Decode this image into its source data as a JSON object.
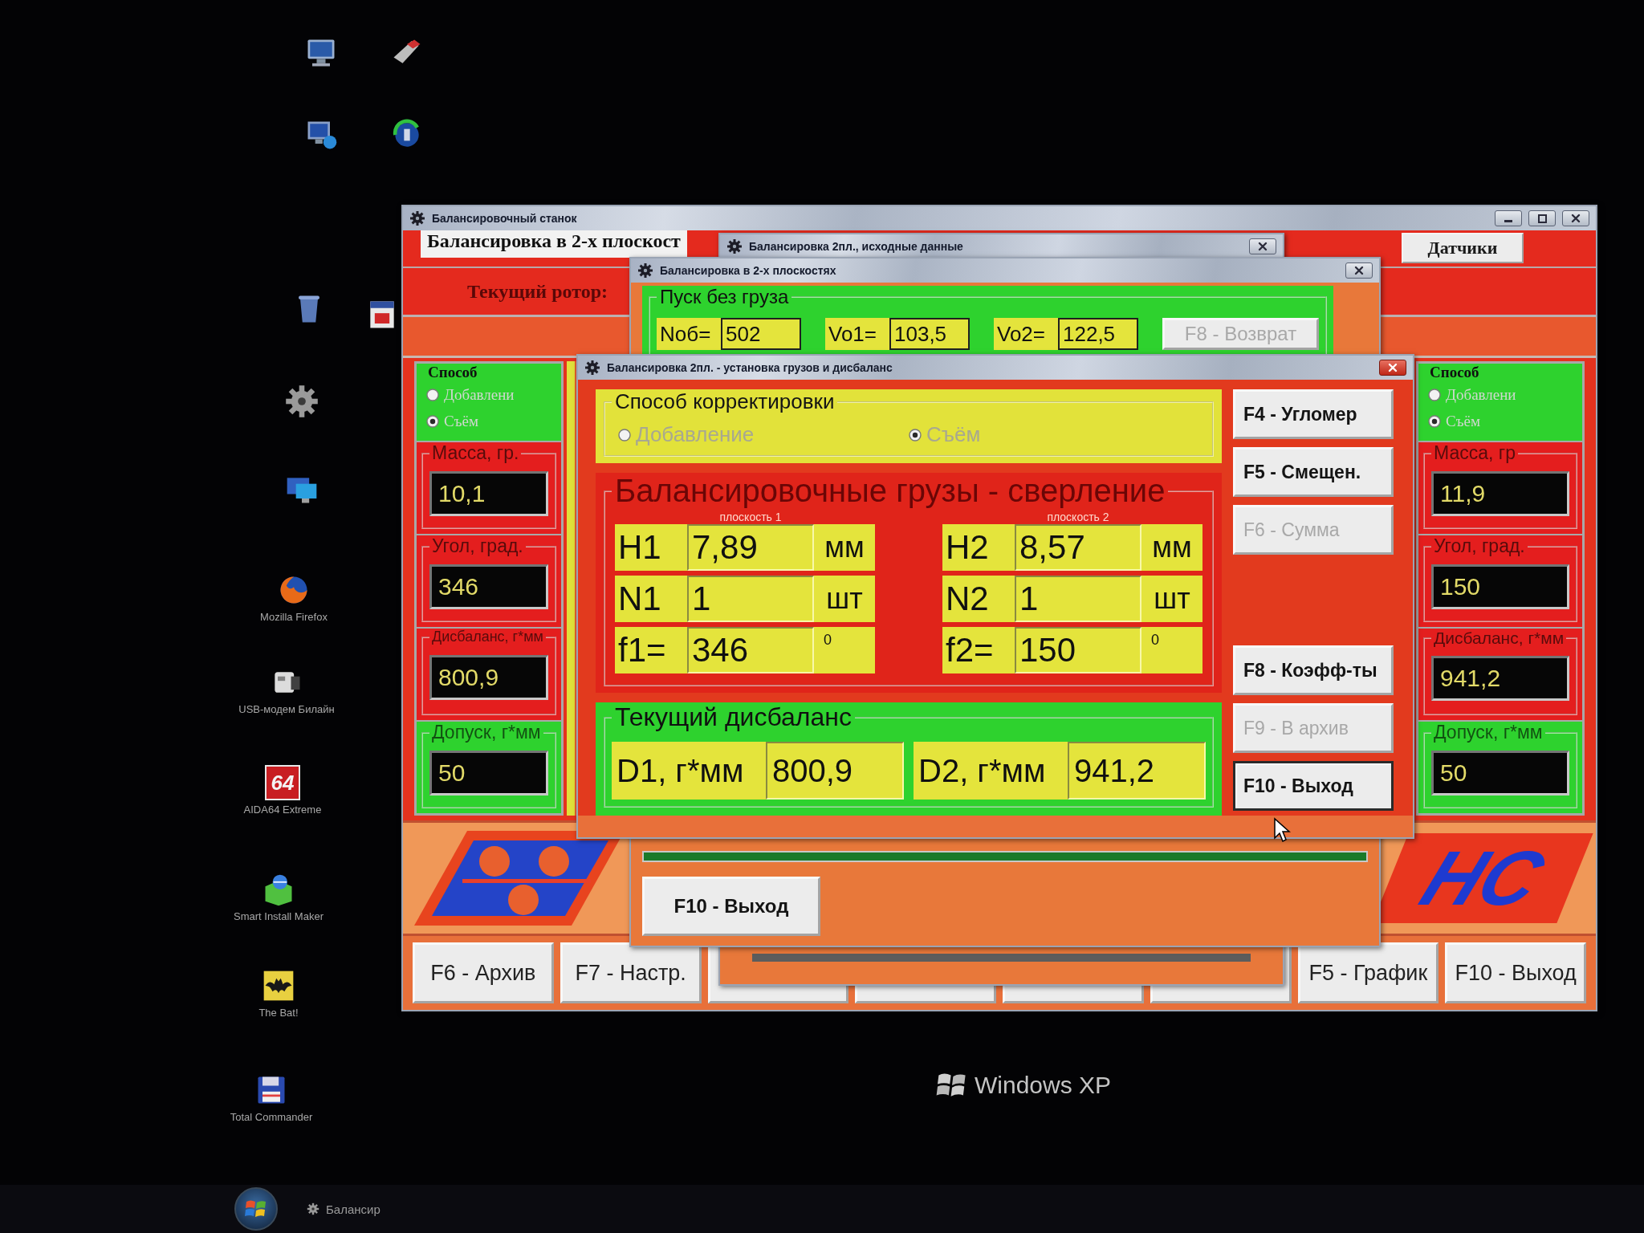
{
  "desktop": {
    "icons": [
      {
        "kind": "computer"
      },
      {
        "kind": "shortcut"
      },
      {
        "kind": "network"
      },
      {
        "kind": "globe"
      },
      {
        "kind": "recycle"
      },
      {
        "kind": "calendar"
      },
      {
        "kind": "gear"
      },
      {
        "kind": "monitor"
      },
      {
        "kind": "browser",
        "label": "Mozilla Firefox"
      },
      {
        "kind": "modem",
        "label": "USB-модем Билайн"
      },
      {
        "kind": "benchmark",
        "text": "64",
        "label": "AIDA64 Extreme"
      },
      {
        "kind": "installer",
        "label": "Smart Install Maker"
      },
      {
        "kind": "bat",
        "label": "The Bat!"
      },
      {
        "kind": "floppy",
        "label": "Total Commander"
      }
    ],
    "taskbar": {
      "items": [
        {
          "label": "Балансир"
        }
      ]
    },
    "bezel_label": "Windows XP"
  },
  "main_window": {
    "title": "Балансировочный станок",
    "header": "Балансировка в 2-х плоскост",
    "sensors_button": "Датчики",
    "rotor_label": "Текущий ротор:",
    "panels": [
      {
        "method": {
          "title": "Способ",
          "options": [
            {
              "label": "Добавлени",
              "selected": false,
              "disabled": true
            },
            {
              "label": "Съём",
              "selected": true,
              "disabled": true
            }
          ]
        },
        "readouts": [
          {
            "title": "Масса, гр.",
            "value": "10,1",
            "color": "#e41e1e"
          },
          {
            "title": "Угол, град.",
            "value": "346",
            "color": "#e41e1e"
          },
          {
            "title": "Дисбаланс, г*мм",
            "value": "800,9",
            "color": "#e41e1e"
          },
          {
            "title": "Допуск, г*мм",
            "value": "50",
            "color": "#2ed22e"
          }
        ]
      },
      {
        "method": {
          "title": "Способ",
          "options": [
            {
              "label": "Добавлени",
              "selected": false,
              "disabled": true
            },
            {
              "label": "Съём",
              "selected": true,
              "disabled": true
            }
          ]
        },
        "readouts": [
          {
            "title": "Масса, гр",
            "value": "11,9",
            "color": "#e41e1e"
          },
          {
            "title": "Угол, град.",
            "value": "150",
            "color": "#e41e1e"
          },
          {
            "title": "Дисбаланс, г*мм",
            "value": "941,2",
            "color": "#e41e1e"
          },
          {
            "title": "Допуск, г*мм",
            "value": "50",
            "color": "#2ed22e"
          }
        ]
      }
    ],
    "logo_text": "НС",
    "buttons": [
      {
        "kind": "labeled",
        "label": "F6 - Архив"
      },
      {
        "kind": "labeled",
        "label": "F7 - Настр."
      },
      {
        "kind": "blank"
      },
      {
        "kind": "blank"
      },
      {
        "kind": "blank"
      },
      {
        "kind": "blank"
      },
      {
        "kind": "labeled",
        "label": "F5 - График"
      },
      {
        "kind": "labeled",
        "label": "F10 - Выход"
      }
    ]
  },
  "input_window": {
    "title": "Балансировка 2пл., исходные данные"
  },
  "run_window": {
    "title": "Балансировка в 2-х плоскостях",
    "group_title": "Пуск без груза",
    "fields": [
      {
        "label": "Nоб=",
        "value": "502"
      },
      {
        "label": "Vo1=",
        "value": "103,5"
      },
      {
        "label": "Vo2=",
        "value": "122,5"
      }
    ],
    "return_button": {
      "label": "F8 - Возврат",
      "disabled": true
    },
    "exit_button": {
      "label": "F10 - Выход"
    }
  },
  "weights_window": {
    "title": "Балансировка 2пл. - установка грузов и дисбаланс",
    "correction": {
      "title": "Способ корректировки",
      "options": [
        {
          "label": "Добавление",
          "selected": false,
          "disabled": true
        },
        {
          "label": "Съём",
          "selected": true,
          "disabled": true
        }
      ]
    },
    "weights": {
      "title": "Балансировочные грузы - сверление",
      "planes": [
        {
          "caption": "плоскость 1",
          "rows": [
            {
              "kind": "length",
              "label": "H1",
              "value": "7,89",
              "unit": "мм"
            },
            {
              "kind": "count",
              "label": "N1",
              "value": "1",
              "unit": "шт"
            },
            {
              "kind": "angle",
              "label": "f1=",
              "value": "346",
              "unit": "0"
            }
          ]
        },
        {
          "caption": "плоскость 2",
          "rows": [
            {
              "kind": "length",
              "label": "H2",
              "value": "8,57",
              "unit": "мм"
            },
            {
              "kind": "count",
              "label": "N2",
              "value": "1",
              "unit": "шт"
            },
            {
              "kind": "angle",
              "label": "f2=",
              "value": "150",
              "unit": "0"
            }
          ]
        }
      ]
    },
    "imbalance": {
      "title": "Текущий дисбаланс",
      "fields": [
        {
          "label": "D1, г*мм",
          "value": "800,9"
        },
        {
          "label": "D2, г*мм",
          "value": "941,2"
        }
      ]
    },
    "buttons_top": [
      {
        "label": "F4 - Угломер",
        "disabled": false,
        "focused": false
      },
      {
        "label": "F5 - Смещен.",
        "disabled": false,
        "focused": false
      },
      {
        "label": "F6 - Сумма",
        "disabled": true,
        "focused": false
      }
    ],
    "buttons_bottom": [
      {
        "label": "F8 - Коэфф-ты",
        "disabled": false,
        "focused": false
      },
      {
        "label": "F9 - В архив",
        "disabled": true,
        "focused": false
      },
      {
        "label": "F10 - Выход",
        "disabled": false,
        "focused": true
      }
    ]
  }
}
